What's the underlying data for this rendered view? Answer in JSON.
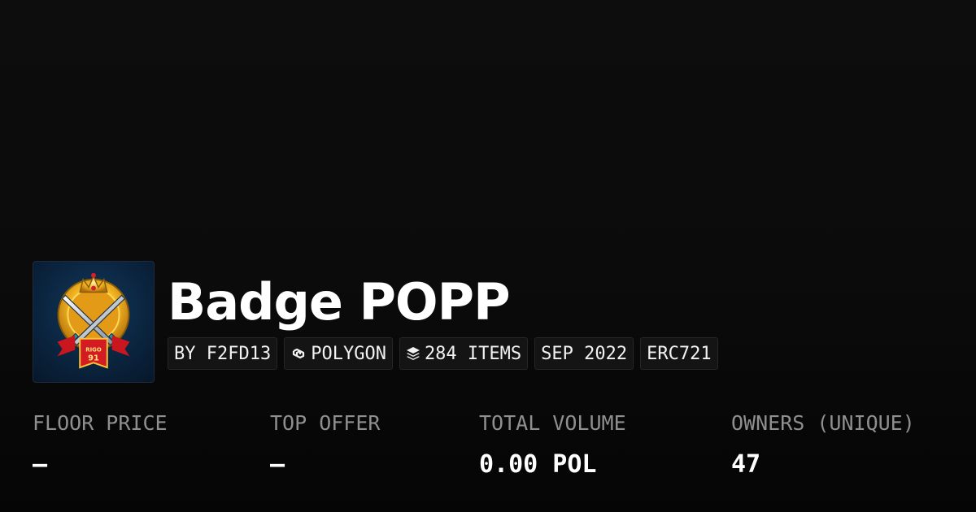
{
  "collection": {
    "name": "Badge POPP",
    "avatar_icon": "badge-crossed-swords-icon",
    "avatar_badge_text": "RIGO",
    "avatar_badge_number": "91"
  },
  "tags": {
    "creator": "BY F2FD13",
    "chain": "POLYGON",
    "chain_icon": "polygon-link-icon",
    "items": "284 ITEMS",
    "items_icon": "layers-stack-icon",
    "date": "SEP 2022",
    "standard": "ERC721"
  },
  "stats": {
    "floor_price": {
      "label": "FLOOR PRICE",
      "value": "—"
    },
    "top_offer": {
      "label": "TOP OFFER",
      "value": "—"
    },
    "total_volume": {
      "label": "TOTAL VOLUME",
      "value": "0.00 POL"
    },
    "owners": {
      "label": "OWNERS (UNIQUE)",
      "value": "47"
    }
  },
  "colors": {
    "background": "#0b0b0b",
    "tag_background": "#141414",
    "label_gray": "#8f8f8f",
    "text": "#ffffff"
  }
}
